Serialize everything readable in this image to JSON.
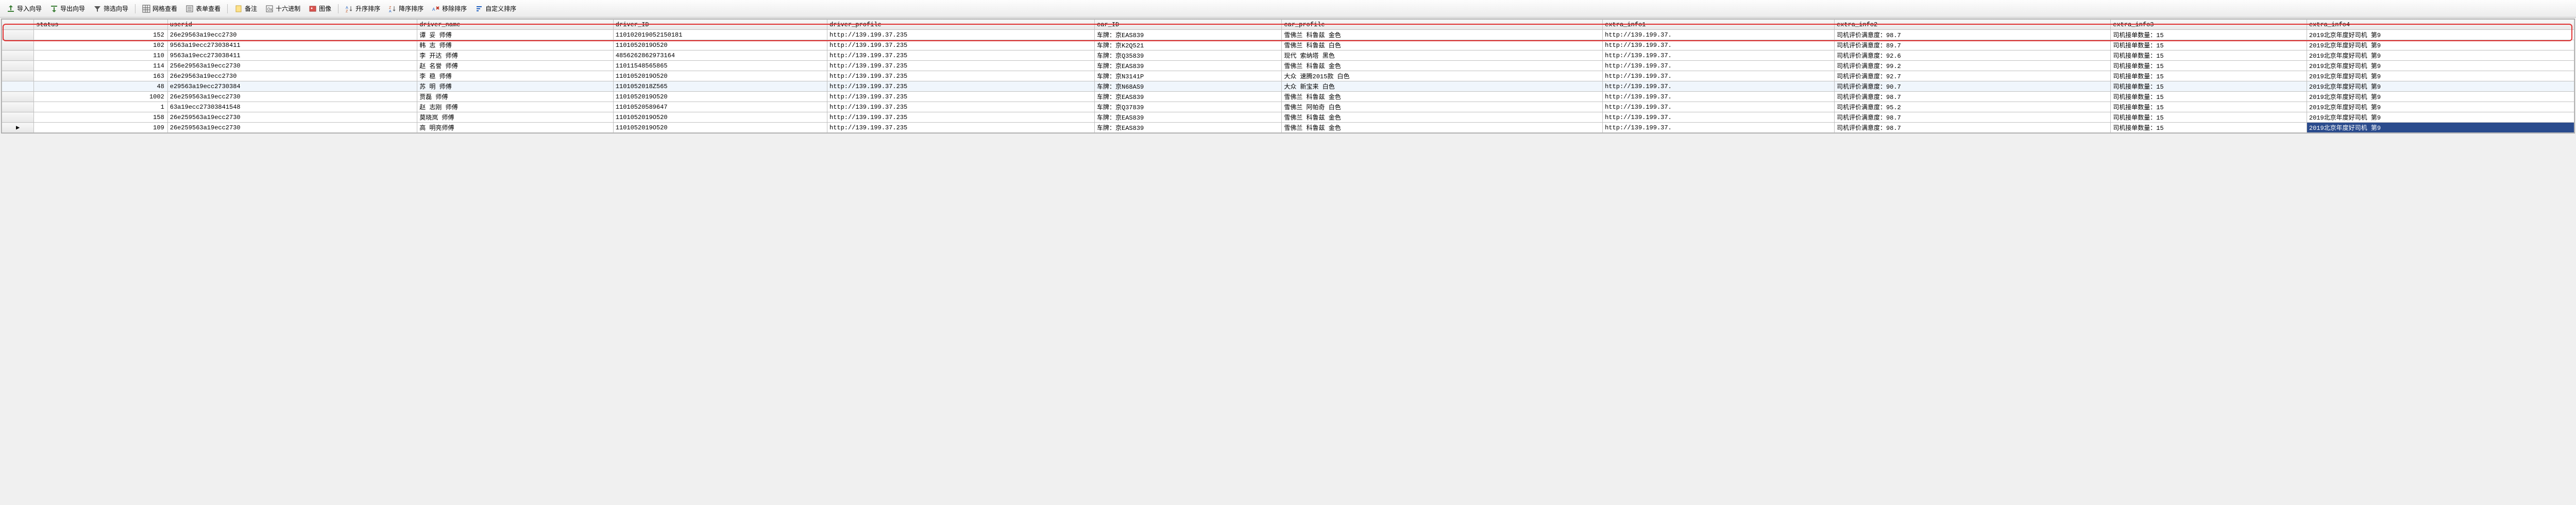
{
  "toolbar": {
    "import_wizard": "导入向导",
    "export_wizard": "导出向导",
    "filter_wizard": "筛选向导",
    "grid_view": "网格查看",
    "form_view": "表单查看",
    "notes": "备注",
    "hex": "十六进制",
    "image": "图像",
    "sort_asc": "升序排序",
    "sort_desc": "降序排序",
    "remove_sort": "移除排序",
    "custom_sort": "自定义排序"
  },
  "columns": [
    "status",
    "userid",
    "driver_name",
    "driver_ID",
    "driver_profile",
    "car_ID",
    "car_profile",
    "extra_info1",
    "extra_info2",
    "extra_info3",
    "extra_info4"
  ],
  "rows": [
    {
      "status": "152",
      "userid": "26e29563a19ecc2730",
      "driver_name": "谭 妥  师傅",
      "driver_ID": "110102019052150181",
      "driver_profile": "http://139.199.37.235",
      "car_ID": "车牌：京EAS839",
      "car_profile": "雪佛兰 科鲁兹 金色",
      "extra_info1": "http://139.199.37.",
      "extra_info2": "司机评价满意度：98.7",
      "extra_info3": "司机接单数量：15",
      "extra_info4": "2019北京年度好司机 第9"
    },
    {
      "status": "102",
      "userid": "9563a19ecc273038411",
      "driver_name": "韩 志 师傅",
      "driver_ID": "1101052019O520",
      "driver_profile": "http://139.199.37.235",
      "car_ID": "车牌：京K2Q521",
      "car_profile": "雪佛兰 科鲁兹 白色",
      "extra_info1": "http://139.199.37.",
      "extra_info2": "司机评价满意度：89.7",
      "extra_info3": "司机接单数量：15",
      "extra_info4": "2019北京年度好司机 第9"
    },
    {
      "status": "110",
      "userid": "9563a19ecc273038411",
      "driver_name": "李 开达 师傅",
      "driver_ID": "4856262862973164",
      "driver_profile": "http://139.199.37.235",
      "car_ID": "车牌：京Q35839",
      "car_profile": "现代  索纳塔  黑色",
      "extra_info1": "http://139.199.37.",
      "extra_info2": "司机评价满意度：92.6",
      "extra_info3": "司机接单数量：15",
      "extra_info4": "2019北京年度好司机 第9"
    },
    {
      "status": "114",
      "userid": "256e29563a19ecc2730",
      "driver_name": "赵 名誉 师傅",
      "driver_ID": "11011548565865",
      "driver_profile": "http://139.199.37.235",
      "car_ID": "车牌：京EAS839",
      "car_profile": "雪佛兰  科鲁兹 金色",
      "extra_info1": "http://139.199.37.",
      "extra_info2": "司机评价满意度：99.2",
      "extra_info3": "司机接单数量：15",
      "extra_info4": "2019北京年度好司机 第9"
    },
    {
      "status": "163",
      "userid": "26e29563a19ecc2730",
      "driver_name": "李 稳 师傅",
      "driver_ID": "1101052019O520",
      "driver_profile": "http://139.199.37.235",
      "car_ID": "车牌：京N3141P",
      "car_profile": "大众 速腾2015款  白色",
      "extra_info1": "http://139.199.37.",
      "extra_info2": "司机评价满意度：92.7",
      "extra_info3": "司机接单数量：15",
      "extra_info4": "2019北京年度好司机 第9"
    },
    {
      "status": "48",
      "userid": "e29563a19ecc2730384",
      "driver_name": "苏 明 师傅",
      "driver_ID": "1101052018Z565",
      "driver_profile": "http://139.199.37.235",
      "car_ID": "车牌：京N68AS9",
      "car_profile": "大众  新宝来  白色",
      "extra_info1": "http://139.199.37.",
      "extra_info2": "司机评价满意度：90.7",
      "extra_info3": "司机接单数量：15",
      "extra_info4": "2019北京年度好司机 第9"
    },
    {
      "status": "1002",
      "userid": "26e259563a19ecc2730",
      "driver_name": "贾磊 师傅",
      "driver_ID": "1101052019O520",
      "driver_profile": "http://139.199.37.235",
      "car_ID": "车牌：京EAS839",
      "car_profile": "雪佛兰  科鲁兹 金色",
      "extra_info1": "http://139.199.37.",
      "extra_info2": "司机评价满意度：98.7",
      "extra_info3": "司机接单数量：15",
      "extra_info4": "2019北京年度好司机 第9"
    },
    {
      "status": "1",
      "userid": "63a19ecc27303841548",
      "driver_name": "赵 志刚 师傅",
      "driver_ID": "11010520589647",
      "driver_profile": "http://139.199.37.235",
      "car_ID": "车牌：京Q37839",
      "car_profile": "雪佛兰  阿帕奇  白色",
      "extra_info1": "http://139.199.37.",
      "extra_info2": "司机评价满意度：95.2",
      "extra_info3": "司机接单数量：15",
      "extra_info4": "2019北京年度好司机 第9"
    },
    {
      "status": "158",
      "userid": "26e259563a19ecc2730",
      "driver_name": "莫晓岚 师傅",
      "driver_ID": "1101052019O520",
      "driver_profile": "http://139.199.37.235",
      "car_ID": "车牌：京EAS839",
      "car_profile": "雪佛兰 科鲁兹 金色",
      "extra_info1": "http://139.199.37.",
      "extra_info2": "司机评价满意度：98.7",
      "extra_info3": "司机接单数量：15",
      "extra_info4": "2019北京年度好司机 第9"
    },
    {
      "status": "109",
      "userid": "26e259563a19ecc2730",
      "driver_name": "高  明亮师傅",
      "driver_ID": "1101052019O520",
      "driver_profile": "http://139.199.37.235",
      "car_ID": "车牌：京EAS839",
      "car_profile": "雪佛兰 科鲁兹 金色",
      "extra_info1": "http://139.199.37.",
      "extra_info2": "司机评价满意度：98.7",
      "extra_info3": "司机接单数量：15",
      "extra_info4": "2019北京年度好司机 第9"
    }
  ],
  "highlight_row_index": 0,
  "current_row_index": 9,
  "selected_cell": {
    "row": 9,
    "col": "extra_info4"
  }
}
